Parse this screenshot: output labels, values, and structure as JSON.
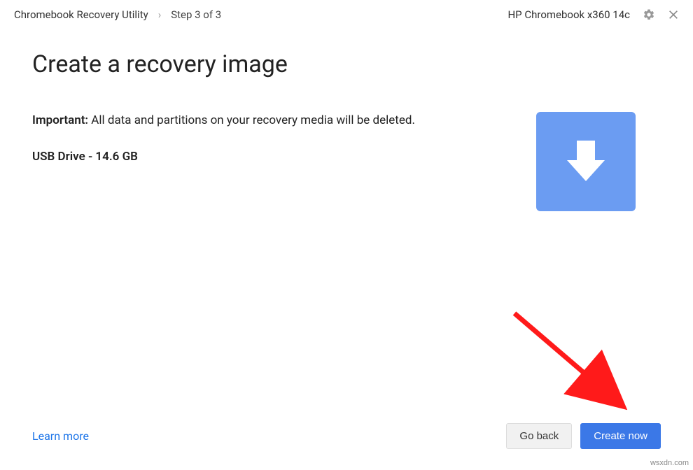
{
  "header": {
    "app_title": "Chromebook Recovery Utility",
    "chevron": "›",
    "step": "Step 3 of 3",
    "device": "HP Chromebook x360 14c"
  },
  "main": {
    "title": "Create a recovery image",
    "important_label": "Important:",
    "important_text": " All data and partitions on your recovery media will be deleted.",
    "drive": "USB Drive - 14.6 GB"
  },
  "footer": {
    "learn_more": "Learn more",
    "go_back": "Go back",
    "create_now": "Create now"
  },
  "watermark": "wsxdn.com",
  "icons": {
    "gear": "gear-icon",
    "close": "close-icon",
    "download": "download-arrow-icon"
  },
  "colors": {
    "accent": "#3b78e7",
    "download_box": "#6b9cf2",
    "link": "#1a73e8"
  }
}
